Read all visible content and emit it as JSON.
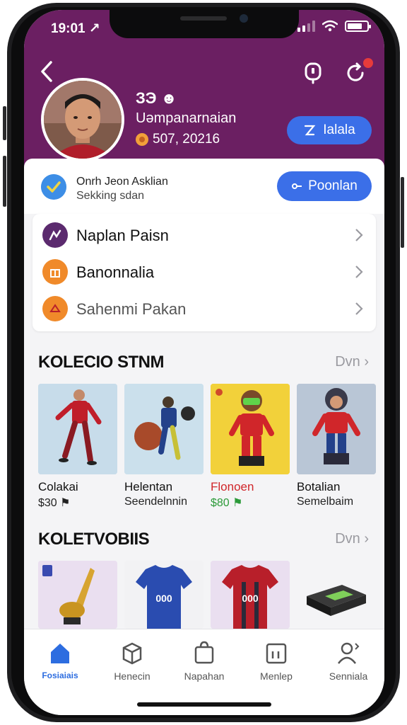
{
  "status_bar": {
    "time": "19:01 ↗"
  },
  "profile": {
    "name": "ЗЭ ☻",
    "subtitle": "Uəmpanarnaian",
    "points": "507, 20216",
    "edit_label": "Ialala"
  },
  "status_card": {
    "title": "Onrh Jeon Asklian",
    "subtitle": "Sekking sdan",
    "button_label": "Poonlan"
  },
  "menu": [
    {
      "label": "Naplan Paisn",
      "icon": "badge-icon",
      "color": "#5b2a6e"
    },
    {
      "label": "Banonnalia",
      "icon": "gift-icon",
      "color": "#f08a2a"
    },
    {
      "label": "Sahenmi Pakan",
      "icon": "ticket-icon",
      "color": "#f08a2a"
    }
  ],
  "collection1": {
    "title": "KOLECIO STNM",
    "more": "Dvn",
    "items": [
      {
        "name": "Colakai",
        "sub": "$30 ⚑",
        "name_color": "",
        "sub_color": ""
      },
      {
        "name": "Helentan",
        "sub": "Seendelnnin",
        "name_color": "",
        "sub_color": ""
      },
      {
        "name": "Flonoen",
        "sub": "$80 ⚑",
        "name_color": "red",
        "sub_color": "green"
      },
      {
        "name": "Botalian",
        "sub": "Semelbaim",
        "name_color": "",
        "sub_color": ""
      }
    ]
  },
  "collection2": {
    "title": "KOLETVOBIIS",
    "more": "Dvn",
    "items": [
      {
        "label": "trophy-icon"
      },
      {
        "label": "shirt-blue",
        "number": "000"
      },
      {
        "label": "shirt-red",
        "number": "000"
      },
      {
        "label": "device"
      }
    ]
  },
  "tabs": [
    {
      "label": "Fosiaiais",
      "icon": "home-icon",
      "active": true
    },
    {
      "label": "Henecin",
      "icon": "box-icon",
      "active": false
    },
    {
      "label": "Napahan",
      "icon": "bag-icon",
      "active": false
    },
    {
      "label": "Menlep",
      "icon": "calendar-icon",
      "active": false
    },
    {
      "label": "Senniala",
      "icon": "profile-icon",
      "active": false
    }
  ],
  "colors": {
    "header": "#6b1f62",
    "accent": "#3b6fe8",
    "active_tab": "#2d6de0"
  }
}
